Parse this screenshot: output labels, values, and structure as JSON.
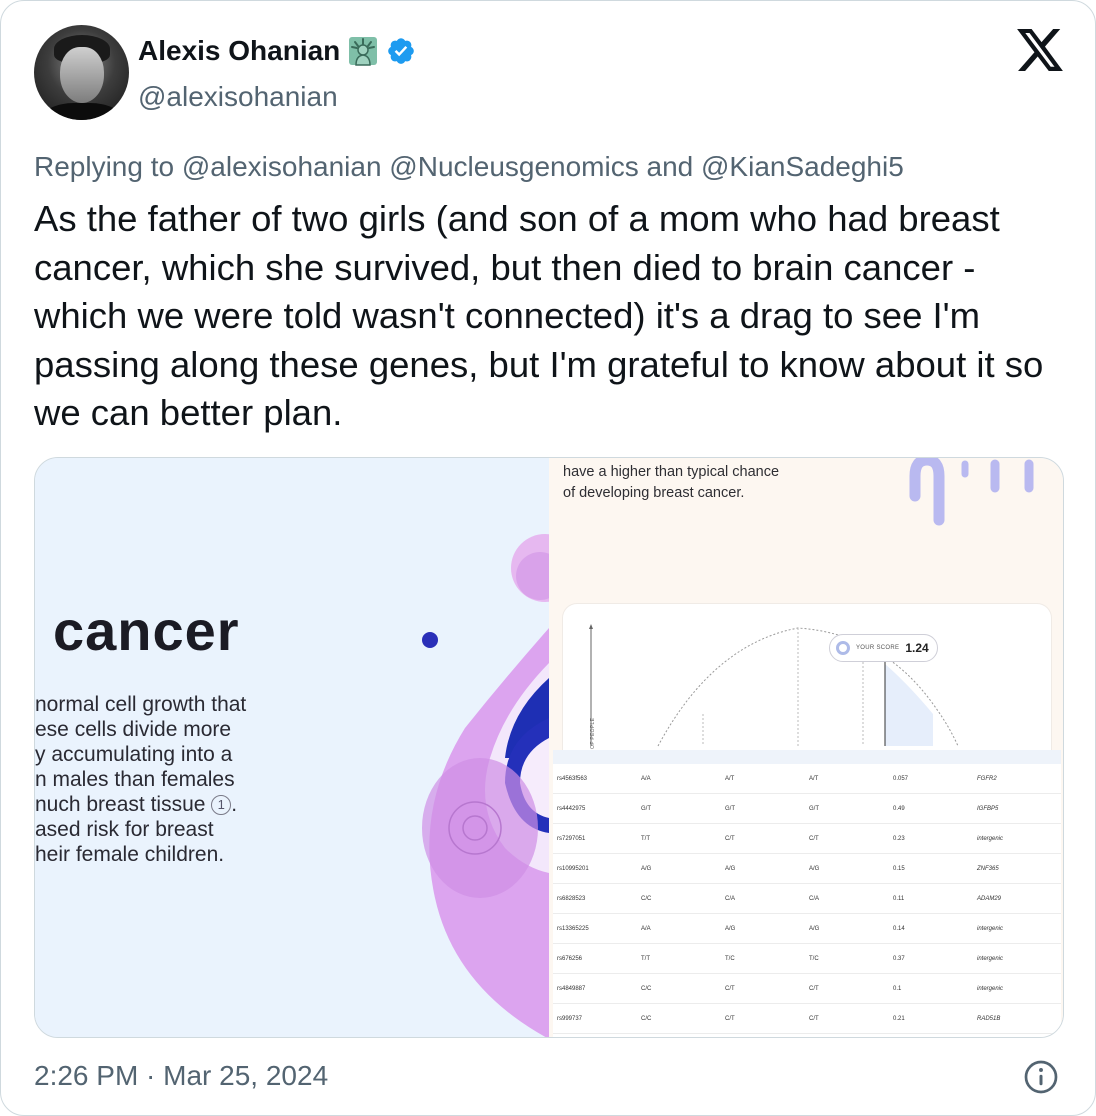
{
  "author": {
    "display_name": "Alexis Ohanian",
    "handle": "@alexisohanian",
    "emoji_icon": "statue-of-liberty-icon",
    "badge_icon": "verified-badge-icon",
    "badge_color": "#1d9bf0"
  },
  "brand_icon": "x-logo-icon",
  "reply": {
    "prefix": "Replying to",
    "handles": [
      "@alexisohanian",
      "@Nucleusgenomics"
    ],
    "joiner": "and",
    "last_handle": "@KianSadeghi5",
    "text": "Replying to @alexisohanian @Nucleusgenomics and @KianSadeghi5"
  },
  "tweet_text": "As the father of two girls (and son of a mom who had breast cancer, which she survived, but then died to brain cancer - which we were told wasn't connected) it's a drag to see I'm passing along these genes, but I'm grateful to know about it so we can better plan.",
  "media": {
    "left": {
      "heading": "cancer",
      "paragraph_lines": [
        "normal cell growth that",
        "ese cells divide more",
        "y accumulating into a",
        "n males than females",
        "nuch breast tissue",
        "ased risk for breast",
        "heir female children."
      ],
      "footnote": "1",
      "footnote_suffix": "."
    },
    "right": {
      "caption_lines": [
        "have a higher than typical chance",
        "of developing breast cancer."
      ],
      "score_label": "YOUR SCORE",
      "score_value": "1.24",
      "y_axis_label": "NUMBER OF PEOPLE",
      "table_rows": [
        [
          "rs4563f563",
          "A/A",
          "A/T",
          "A/T",
          "0.057",
          "FGFR2"
        ],
        [
          "rs4442975",
          "G/T",
          "G/T",
          "G/T",
          "0.49",
          "IGFBP5"
        ],
        [
          "rs7297051",
          "T/T",
          "C/T",
          "C/T",
          "0.23",
          "intergenic"
        ],
        [
          "rs10995201",
          "A/G",
          "A/G",
          "A/G",
          "0.15",
          "ZNF365"
        ],
        [
          "rs6828523",
          "C/C",
          "C/A",
          "C/A",
          "0.11",
          "ADAM29"
        ],
        [
          "rs13365225",
          "A/A",
          "A/G",
          "A/G",
          "0.14",
          "intergenic"
        ],
        [
          "rs676256",
          "T/T",
          "T/C",
          "T/C",
          "0.37",
          "intergenic"
        ],
        [
          "rs4849887",
          "C/C",
          "C/T",
          "C/T",
          "0.1",
          "intergenic"
        ],
        [
          "rs999737",
          "C/C",
          "C/T",
          "C/T",
          "0.21",
          "RAD51B"
        ]
      ]
    }
  },
  "timestamp": "2:26 PM · Mar 25, 2024",
  "info_icon": "info-icon",
  "colors": {
    "text_primary": "#0f1419",
    "text_secondary": "#536471",
    "border": "#cfd9de",
    "accent_blue": "#1d9bf0"
  }
}
